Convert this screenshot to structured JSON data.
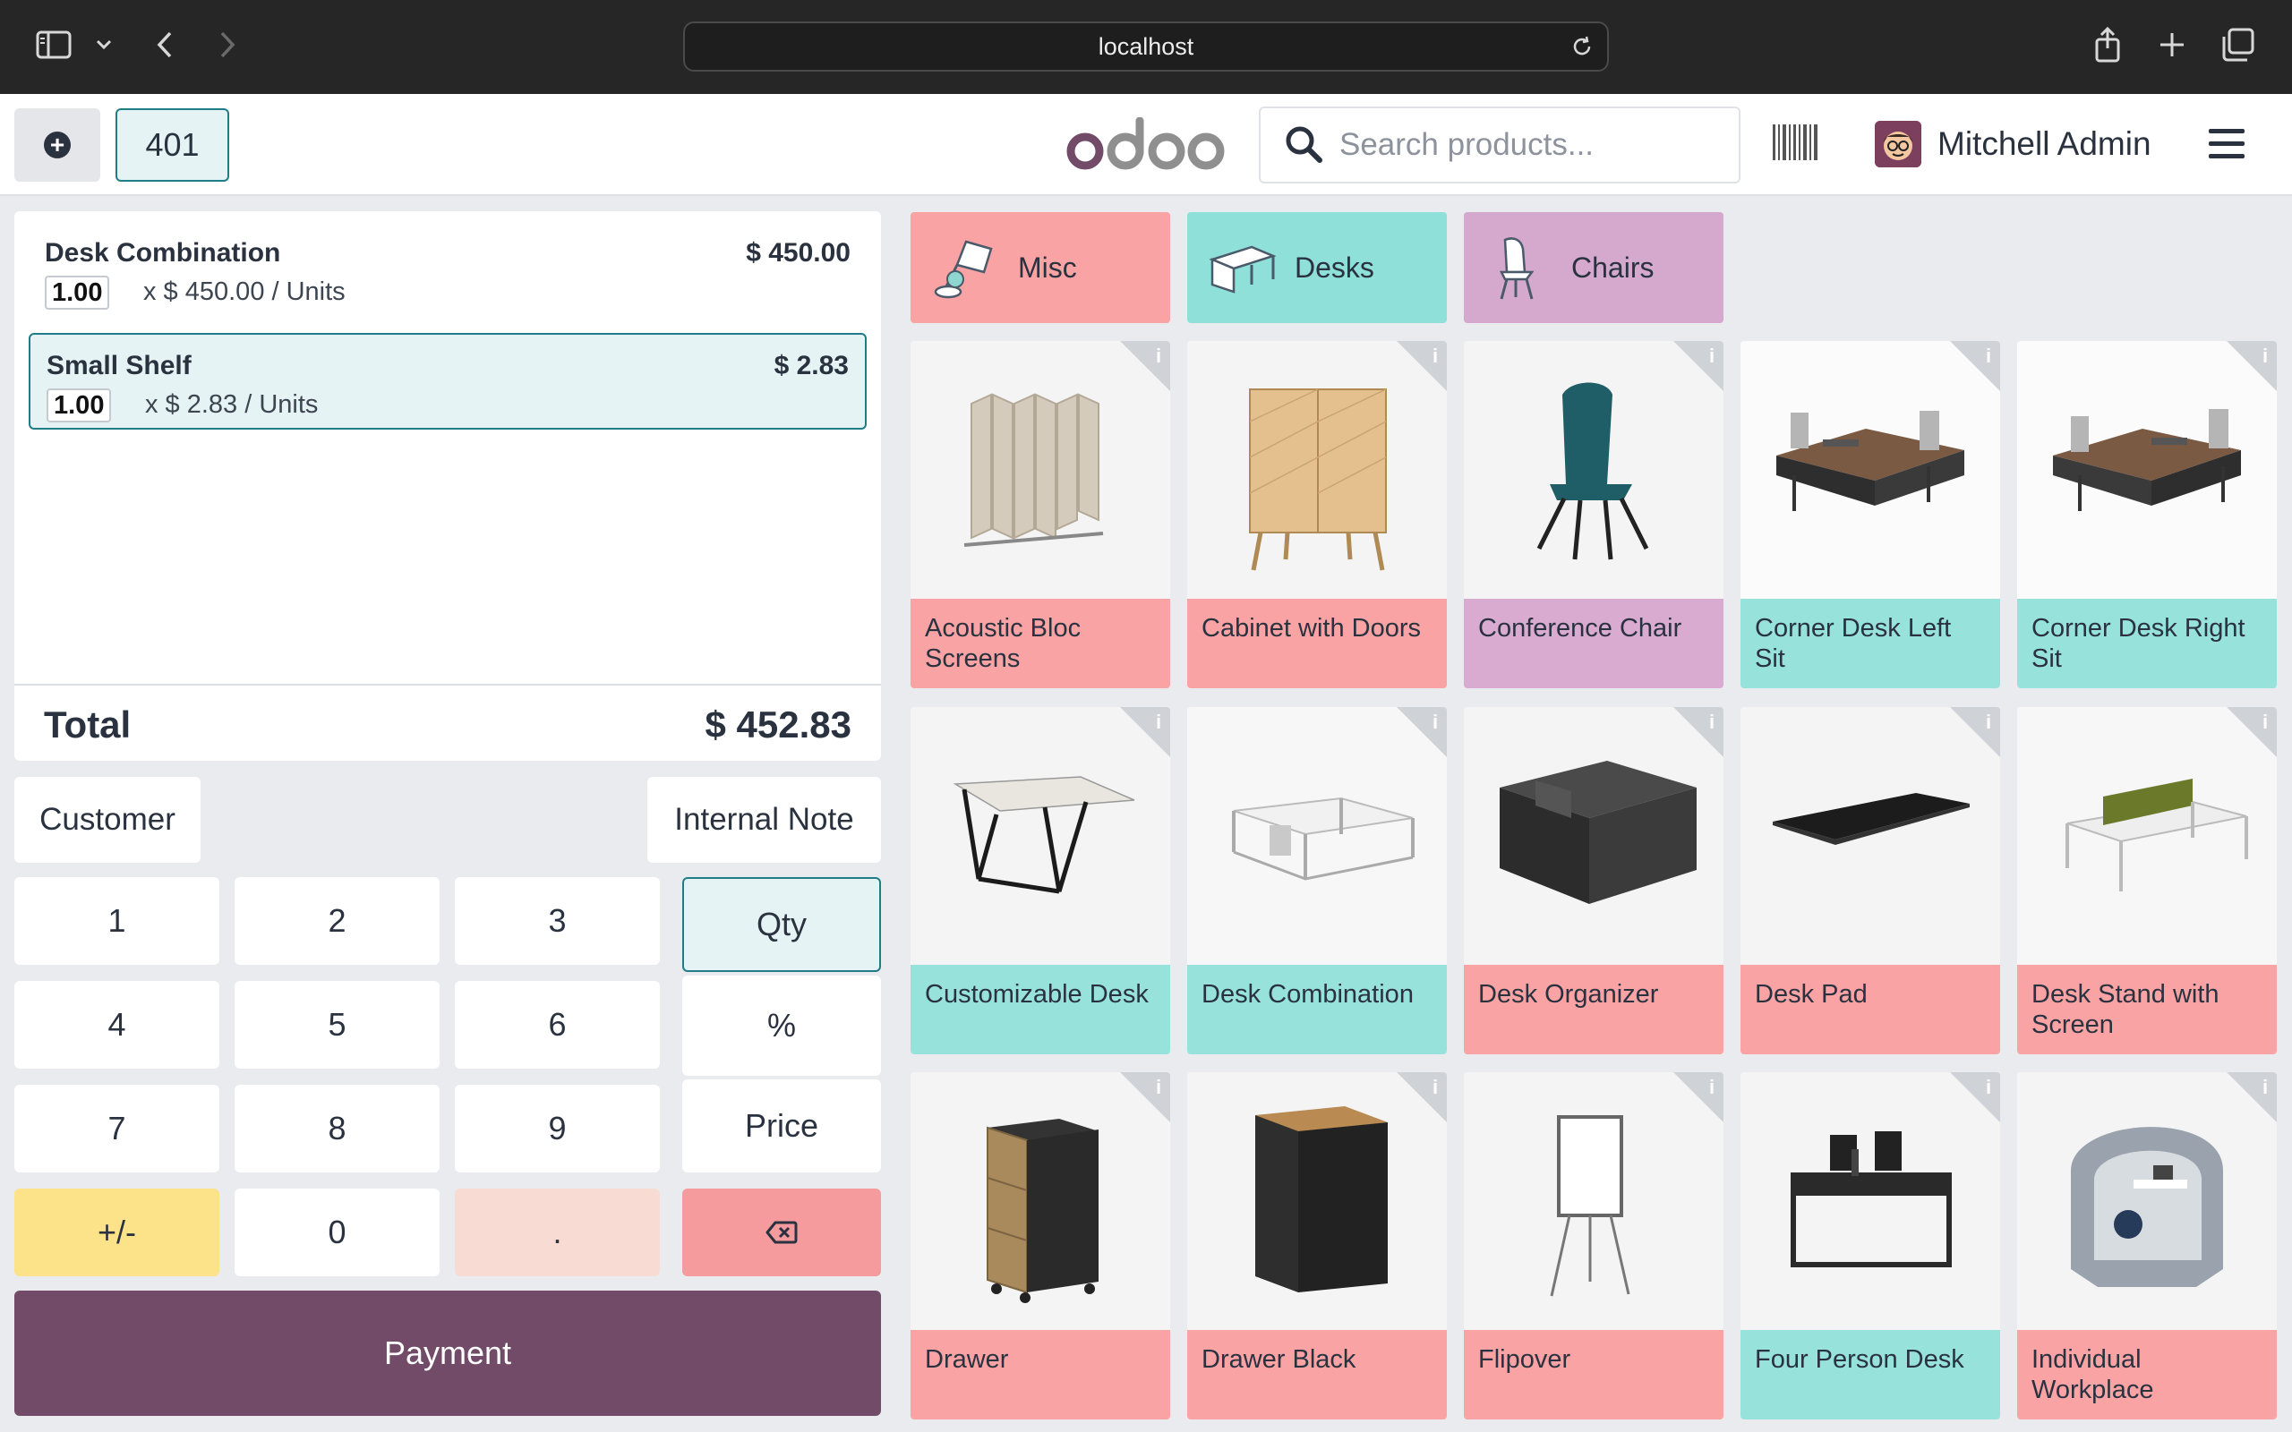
{
  "browser": {
    "url": "localhost"
  },
  "navbar": {
    "order_number": "401",
    "logo_text": "odoo",
    "search_placeholder": "Search products...",
    "user_name": "Mitchell Admin"
  },
  "order": {
    "lines": [
      {
        "name": "Desk Combination",
        "price": "$ 450.00",
        "qty": "1.00",
        "unit_info": "x $ 450.00 / Units",
        "selected": false
      },
      {
        "name": "Small Shelf",
        "price": "$ 2.83",
        "qty": "1.00",
        "unit_info": "x $ 2.83 / Units",
        "selected": true
      }
    ],
    "total_label": "Total",
    "total_value": "$ 452.83"
  },
  "controls": {
    "customer_label": "Customer",
    "note_label": "Internal Note"
  },
  "numpad": {
    "keys": [
      "1",
      "2",
      "3",
      "4",
      "5",
      "6",
      "7",
      "8",
      "9",
      "+/-",
      "0",
      "."
    ],
    "modes": [
      "Qty",
      "%",
      "Price"
    ],
    "active_mode": "Qty"
  },
  "payment_label": "Payment",
  "categories": [
    {
      "label": "Misc",
      "color": "#f9a3a4",
      "icon": "lamp-icon"
    },
    {
      "label": "Desks",
      "color": "#8fe0d9",
      "icon": "desk-icon"
    },
    {
      "label": "Chairs",
      "color": "#d4a9cd",
      "icon": "chair-icon"
    }
  ],
  "products": [
    {
      "name": "Acoustic Bloc Screens",
      "category": "Misc",
      "image": "screen-image"
    },
    {
      "name": "Cabinet with Doors",
      "category": "Misc",
      "image": "cabinet-image"
    },
    {
      "name": "Conference Chair",
      "category": "Chairs",
      "image": "chair-image"
    },
    {
      "name": "Corner Desk Left Sit",
      "category": "Desks",
      "image": "corner-desk-image"
    },
    {
      "name": "Corner Desk Right Sit",
      "category": "Desks",
      "image": "corner-desk-image"
    },
    {
      "name": "Customizable Desk",
      "category": "Desks",
      "image": "table-image"
    },
    {
      "name": "Desk Combination",
      "category": "Desks",
      "image": "desk-combination-image"
    },
    {
      "name": "Desk Organizer",
      "category": "Misc",
      "image": "organizer-image"
    },
    {
      "name": "Desk Pad",
      "category": "Misc",
      "image": "desk-pad-image"
    },
    {
      "name": "Desk Stand with Screen",
      "category": "Misc",
      "image": "desk-stand-image"
    },
    {
      "name": "Drawer",
      "category": "Misc",
      "image": "drawer-image"
    },
    {
      "name": "Drawer Black",
      "category": "Misc",
      "image": "drawer-black-image"
    },
    {
      "name": "Flipover",
      "category": "Misc",
      "image": "flipover-image"
    },
    {
      "name": "Four Person Desk",
      "category": "Desks",
      "image": "four-person-desk-image"
    },
    {
      "name": "Individual Workplace",
      "category": "Misc",
      "image": "workplace-image"
    }
  ]
}
